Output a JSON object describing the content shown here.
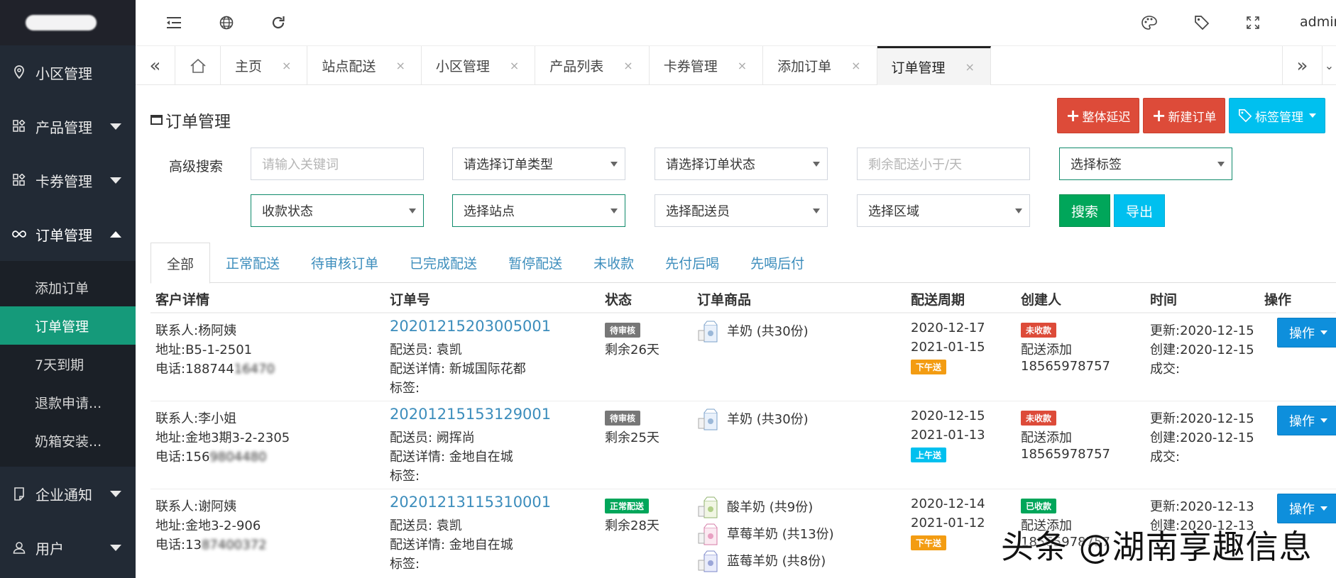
{
  "topbar": {
    "admin": "admin"
  },
  "sidebar": {
    "items": [
      {
        "label": "小区管理",
        "icon": "location-pin-icon"
      },
      {
        "label": "产品管理",
        "icon": "grid-icon"
      },
      {
        "label": "卡券管理",
        "icon": "grid-icon"
      },
      {
        "label": "订单管理",
        "icon": "infinity-icon"
      },
      {
        "label": "企业通知",
        "icon": "document-icon"
      },
      {
        "label": "用户",
        "icon": "user-icon"
      }
    ],
    "submenu": [
      "添加订单",
      "订单管理",
      "7天到期",
      "退款申请...",
      "奶箱安装..."
    ]
  },
  "tabs": [
    "主页",
    "站点配送",
    "小区管理",
    "产品列表",
    "卡券管理",
    "添加订单",
    "订单管理"
  ],
  "tab_close": "×",
  "page": {
    "title": "订单管理",
    "btn_delay": "整体延迟",
    "btn_new": "新建订单",
    "btn_tags": "标签管理",
    "plus": "+"
  },
  "search": {
    "label": "高级搜索",
    "keyword_placeholder": "请输入关键词",
    "order_type": "请选择订单类型",
    "order_status": "请选择订单状态",
    "remain_placeholder": "剩余配送小于/天",
    "tag": "选择标签",
    "payment": "收款状态",
    "station": "选择站点",
    "courier": "选择配送员",
    "area": "选择区域",
    "btn_search": "搜索",
    "btn_export": "导出"
  },
  "status_tabs": [
    "全部",
    "正常配送",
    "待审核订单",
    "已完成配送",
    "暂停配送",
    "未收款",
    "先付后喝",
    "先喝后付"
  ],
  "table": {
    "headers": [
      "客户详情",
      "订单号",
      "状态",
      "订单商品",
      "配送周期",
      "创建人",
      "时间",
      "操作"
    ],
    "op_label": "操作",
    "rows": [
      {
        "contact": "联系人:杨阿姨",
        "address": "地址:B5-1-2501",
        "phone": "电话:188744",
        "phone_blur": "16470",
        "order_no": "20201215203005001",
        "courier": "配送员: 袁凯",
        "detail": "配送详情: 新城国际花都",
        "tag": "标签:",
        "status_badge": "待审核",
        "remain": "剩余26天",
        "products": [
          "羊奶 (共30份)"
        ],
        "start": "2020-12-17",
        "end": "2021-01-15",
        "slot": "下午送",
        "pay_badge": "未收款",
        "creator": "配送添加",
        "creator_phone": "18565978757",
        "updated": "更新:2020-12-15",
        "created": "创建:2020-12-15",
        "deal": "成交:"
      },
      {
        "contact": "联系人:李小姐",
        "address": "地址:金地3期3-2-2305",
        "phone": "电话:156",
        "phone_blur": "9804480",
        "order_no": "20201215153129001",
        "courier": "配送员: 阙挥尚",
        "detail": "配送详情: 金地自在城",
        "tag": "标签:",
        "status_badge": "待审核",
        "remain": "剩余25天",
        "products": [
          "羊奶 (共30份)"
        ],
        "start": "2020-12-15",
        "end": "2021-01-13",
        "slot": "上午送",
        "pay_badge": "未收款",
        "creator": "配送添加",
        "creator_phone": "18565978757",
        "updated": "更新:2020-12-15",
        "created": "创建:2020-12-15",
        "deal": "成交:"
      },
      {
        "contact": "联系人:谢阿姨",
        "address": "地址:金地3-2-906",
        "phone": "电话:13",
        "phone_blur": "87400372",
        "order_no": "20201213115310001",
        "courier": "配送员: 袁凯",
        "detail": "配送详情: 金地自在城",
        "tag": "标签:",
        "status_badge": "正常配送",
        "remain": "剩余28天",
        "products": [
          "酸羊奶 (共9份)",
          "草莓羊奶 (共13份)",
          "蓝莓羊奶 (共8份)"
        ],
        "start": "2020-12-14",
        "end": "2021-01-12",
        "slot": "下午送",
        "pay_badge": "已收款",
        "creator": "配送添加",
        "creator_phone": "18565978757",
        "updated": "更新:2020-12-13",
        "created": "创建:2020-12-13",
        "deal": ""
      }
    ]
  },
  "watermark": "头条 @湖南享趣信息"
}
